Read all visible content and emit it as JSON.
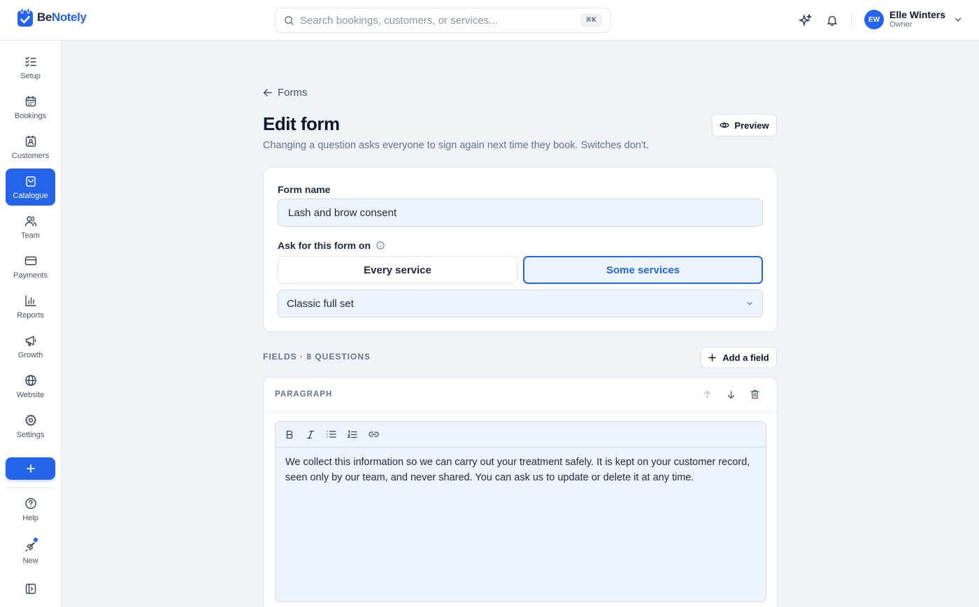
{
  "app": {
    "brand_prefix": "Be",
    "brand_suffix": "Notely"
  },
  "search": {
    "placeholder": "Search bookings, customers, or services...",
    "shortcut": "⌘K"
  },
  "user": {
    "initials": "EW",
    "name": "Elle Winters",
    "role": "Owner"
  },
  "sidebar": {
    "items": [
      {
        "label": "Setup",
        "icon": "checklist-icon"
      },
      {
        "label": "Bookings",
        "icon": "calendar-icon"
      },
      {
        "label": "Customers",
        "icon": "contact-icon"
      },
      {
        "label": "Catalogue",
        "icon": "shopping-bag-icon",
        "active": true
      },
      {
        "label": "Team",
        "icon": "users-icon"
      },
      {
        "label": "Payments",
        "icon": "credit-card-icon"
      },
      {
        "label": "Reports",
        "icon": "bar-chart-icon"
      },
      {
        "label": "Growth",
        "icon": "megaphone-icon"
      },
      {
        "label": "Website",
        "icon": "globe-icon"
      },
      {
        "label": "Settings",
        "icon": "gear-icon"
      }
    ],
    "bottom": [
      {
        "label": "Help",
        "icon": "help-circle-icon"
      },
      {
        "label": "New",
        "icon": "rocket-icon"
      }
    ]
  },
  "page": {
    "back_label": "Forms",
    "title": "Edit form",
    "subtitle": "Changing a question asks everyone to sign again next time they book. Switches don't.",
    "preview_label": "Preview"
  },
  "form": {
    "name_label": "Form name",
    "name_value": "Lash and brow consent",
    "ask_label": "Ask for this form on",
    "option_every": "Every service",
    "option_some": "Some services",
    "selected_option": "Some services",
    "service_value": "Classic full set"
  },
  "fields": {
    "heading": "FIELDS · 8 QUESTIONS",
    "add_label": "Add a field",
    "items": [
      {
        "type": "PARAGRAPH",
        "text": "We collect this information so we can carry out your treatment safely. It is kept on your customer record, seen only by our team, and never shared. You can ask us to update or delete it at any time."
      }
    ]
  },
  "colors": {
    "accent": "#2563eb",
    "background": "#eff2f7",
    "input_bg": "#eef4fe"
  }
}
